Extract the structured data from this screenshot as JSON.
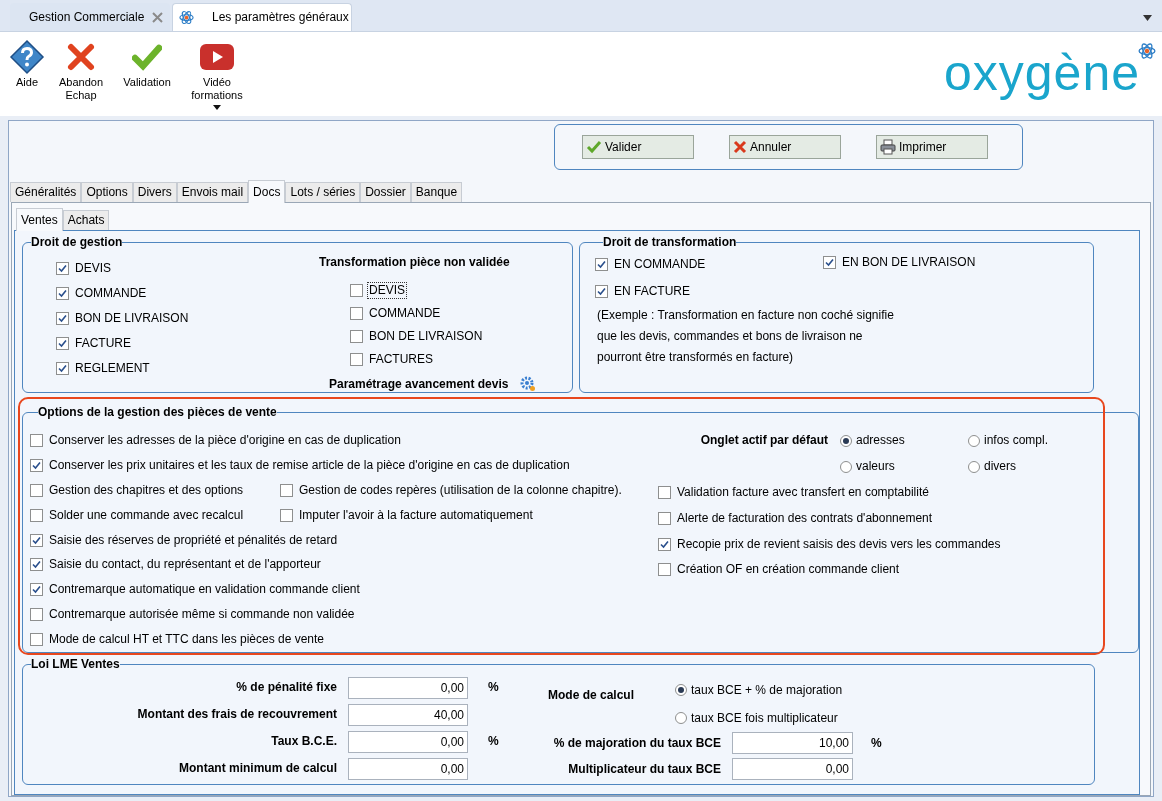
{
  "tabs": [
    {
      "label": "Gestion Commerciale",
      "selected": false,
      "icon": false
    },
    {
      "label": "Les paramètres généraux",
      "selected": true,
      "icon": true
    }
  ],
  "toolbar": [
    {
      "kind": "help",
      "lines": [
        "Aide"
      ],
      "dropdown": false
    },
    {
      "kind": "cancel",
      "lines": [
        "Abandon",
        "Echap"
      ],
      "dropdown": false
    },
    {
      "kind": "validate",
      "lines": [
        "Validation"
      ],
      "dropdown": false
    },
    {
      "kind": "video",
      "lines": [
        "Vidéo",
        "formations"
      ],
      "dropdown": true
    }
  ],
  "logo": "oxygène",
  "actions": [
    {
      "kind": "validate",
      "label": "Valider"
    },
    {
      "kind": "cancel",
      "label": "Annuler"
    },
    {
      "kind": "print",
      "label": "Imprimer"
    }
  ],
  "main_tabs": [
    {
      "label": "Généralités",
      "selected": false
    },
    {
      "label": "Options",
      "selected": false
    },
    {
      "label": "Divers",
      "selected": false
    },
    {
      "label": "Envois mail",
      "selected": false
    },
    {
      "label": "Docs",
      "selected": true
    },
    {
      "label": "Lots / séries",
      "selected": false
    },
    {
      "label": "Dossier",
      "selected": false
    },
    {
      "label": "Banque",
      "selected": false
    }
  ],
  "sub_tabs": [
    {
      "label": "Ventes",
      "selected": true
    },
    {
      "label": "Achats",
      "selected": false
    }
  ],
  "droit_gestion": {
    "title": "Droit de gestion",
    "items": [
      {
        "label": "DEVIS",
        "checked": true
      },
      {
        "label": "COMMANDE",
        "checked": true
      },
      {
        "label": "BON DE LIVRAISON",
        "checked": true
      },
      {
        "label": "FACTURE",
        "checked": true
      },
      {
        "label": "REGLEMENT",
        "checked": true
      }
    ],
    "transformation": {
      "title": "Transformation pièce non validée",
      "items": [
        {
          "label": "DEVIS",
          "checked": false,
          "focused": true
        },
        {
          "label": "COMMANDE",
          "checked": false,
          "focused": false
        },
        {
          "label": "BON DE LIVRAISON",
          "checked": false,
          "focused": false
        },
        {
          "label": "FACTURES",
          "checked": false,
          "focused": false
        }
      ]
    },
    "avancement": "Paramétrage avancement devis"
  },
  "droit_transformation": {
    "title": "Droit de transformation",
    "items": [
      {
        "label": "EN COMMANDE",
        "checked": true
      },
      {
        "label": "EN BON DE LIVRAISON",
        "checked": true
      },
      {
        "label": "EN FACTURE",
        "checked": true
      }
    ],
    "note": [
      "(Exemple : Transformation en facture non coché signifie",
      "que les devis, commandes et bons de livraison ne",
      "pourront être transformés en facture)"
    ]
  },
  "options": {
    "title": "Options de la gestion des pièces de vente",
    "highlighted": true,
    "left_rows": [
      [
        {
          "label": "Conserver les adresses de la pièce d'origine en cas de duplication",
          "checked": false
        }
      ],
      [
        {
          "label": "Conserver les prix unitaires et les taux de remise article de la pièce d'origine en cas de duplication",
          "checked": true
        }
      ],
      [
        {
          "label": "Gestion des chapitres et des options",
          "checked": false
        },
        {
          "label": "Gestion de codes repères (utilisation de la colonne chapitre).",
          "checked": false
        }
      ],
      [
        {
          "label": "Solder une commande avec recalcul",
          "checked": false
        },
        {
          "label": "Imputer l'avoir à la facture automatiquement",
          "checked": false
        }
      ],
      [
        {
          "label": "Saisie des réserves de propriété et pénalités de retard",
          "checked": true
        }
      ],
      [
        {
          "label": "Saisie du contact, du représentant et de l'apporteur",
          "checked": true
        }
      ],
      [
        {
          "label": "Contremarque automatique en validation commande client",
          "checked": true
        }
      ],
      [
        {
          "label": "Contremarque autorisée même si commande non validée",
          "checked": false
        }
      ],
      [
        {
          "label": "Mode de calcul HT et TTC dans les pièces de vente",
          "checked": false
        }
      ]
    ],
    "default_tab": {
      "label": "Onglet actif par défaut",
      "choices": [
        {
          "label": "adresses",
          "selected": true
        },
        {
          "label": "infos compl.",
          "selected": false
        },
        {
          "label": "valeurs",
          "selected": false
        },
        {
          "label": "divers",
          "selected": false
        }
      ]
    },
    "right_items": [
      {
        "label": "Validation facture avec transfert en comptabilité",
        "checked": false
      },
      {
        "label": "Alerte de facturation des contrats d'abonnement",
        "checked": false
      },
      {
        "label": "Recopie prix de revient saisis des devis vers les commandes",
        "checked": true
      },
      {
        "label": "Création OF en création commande client",
        "checked": false
      }
    ]
  },
  "lme": {
    "title": "Loi LME Ventes",
    "fields": [
      {
        "label": "% de pénalité fixe",
        "value": "0,00",
        "unit": "%"
      },
      {
        "label": "Montant des frais de recouvrement",
        "value": "40,00"
      },
      {
        "label": "Taux B.C.E.",
        "value": "0,00",
        "unit": "%"
      },
      {
        "label": "Montant minimum de calcul",
        "value": "0,00"
      }
    ],
    "mode": {
      "label": "Mode de calcul",
      "choices": [
        {
          "label": "taux BCE + % de majoration",
          "selected": true
        },
        {
          "label": "taux BCE fois multiplicateur",
          "selected": false
        }
      ]
    },
    "right_fields": [
      {
        "label": "% de majoration du taux BCE",
        "value": "10,00",
        "unit": "%"
      },
      {
        "label": "Multiplicateur du taux BCE",
        "value": "0,00"
      }
    ]
  }
}
